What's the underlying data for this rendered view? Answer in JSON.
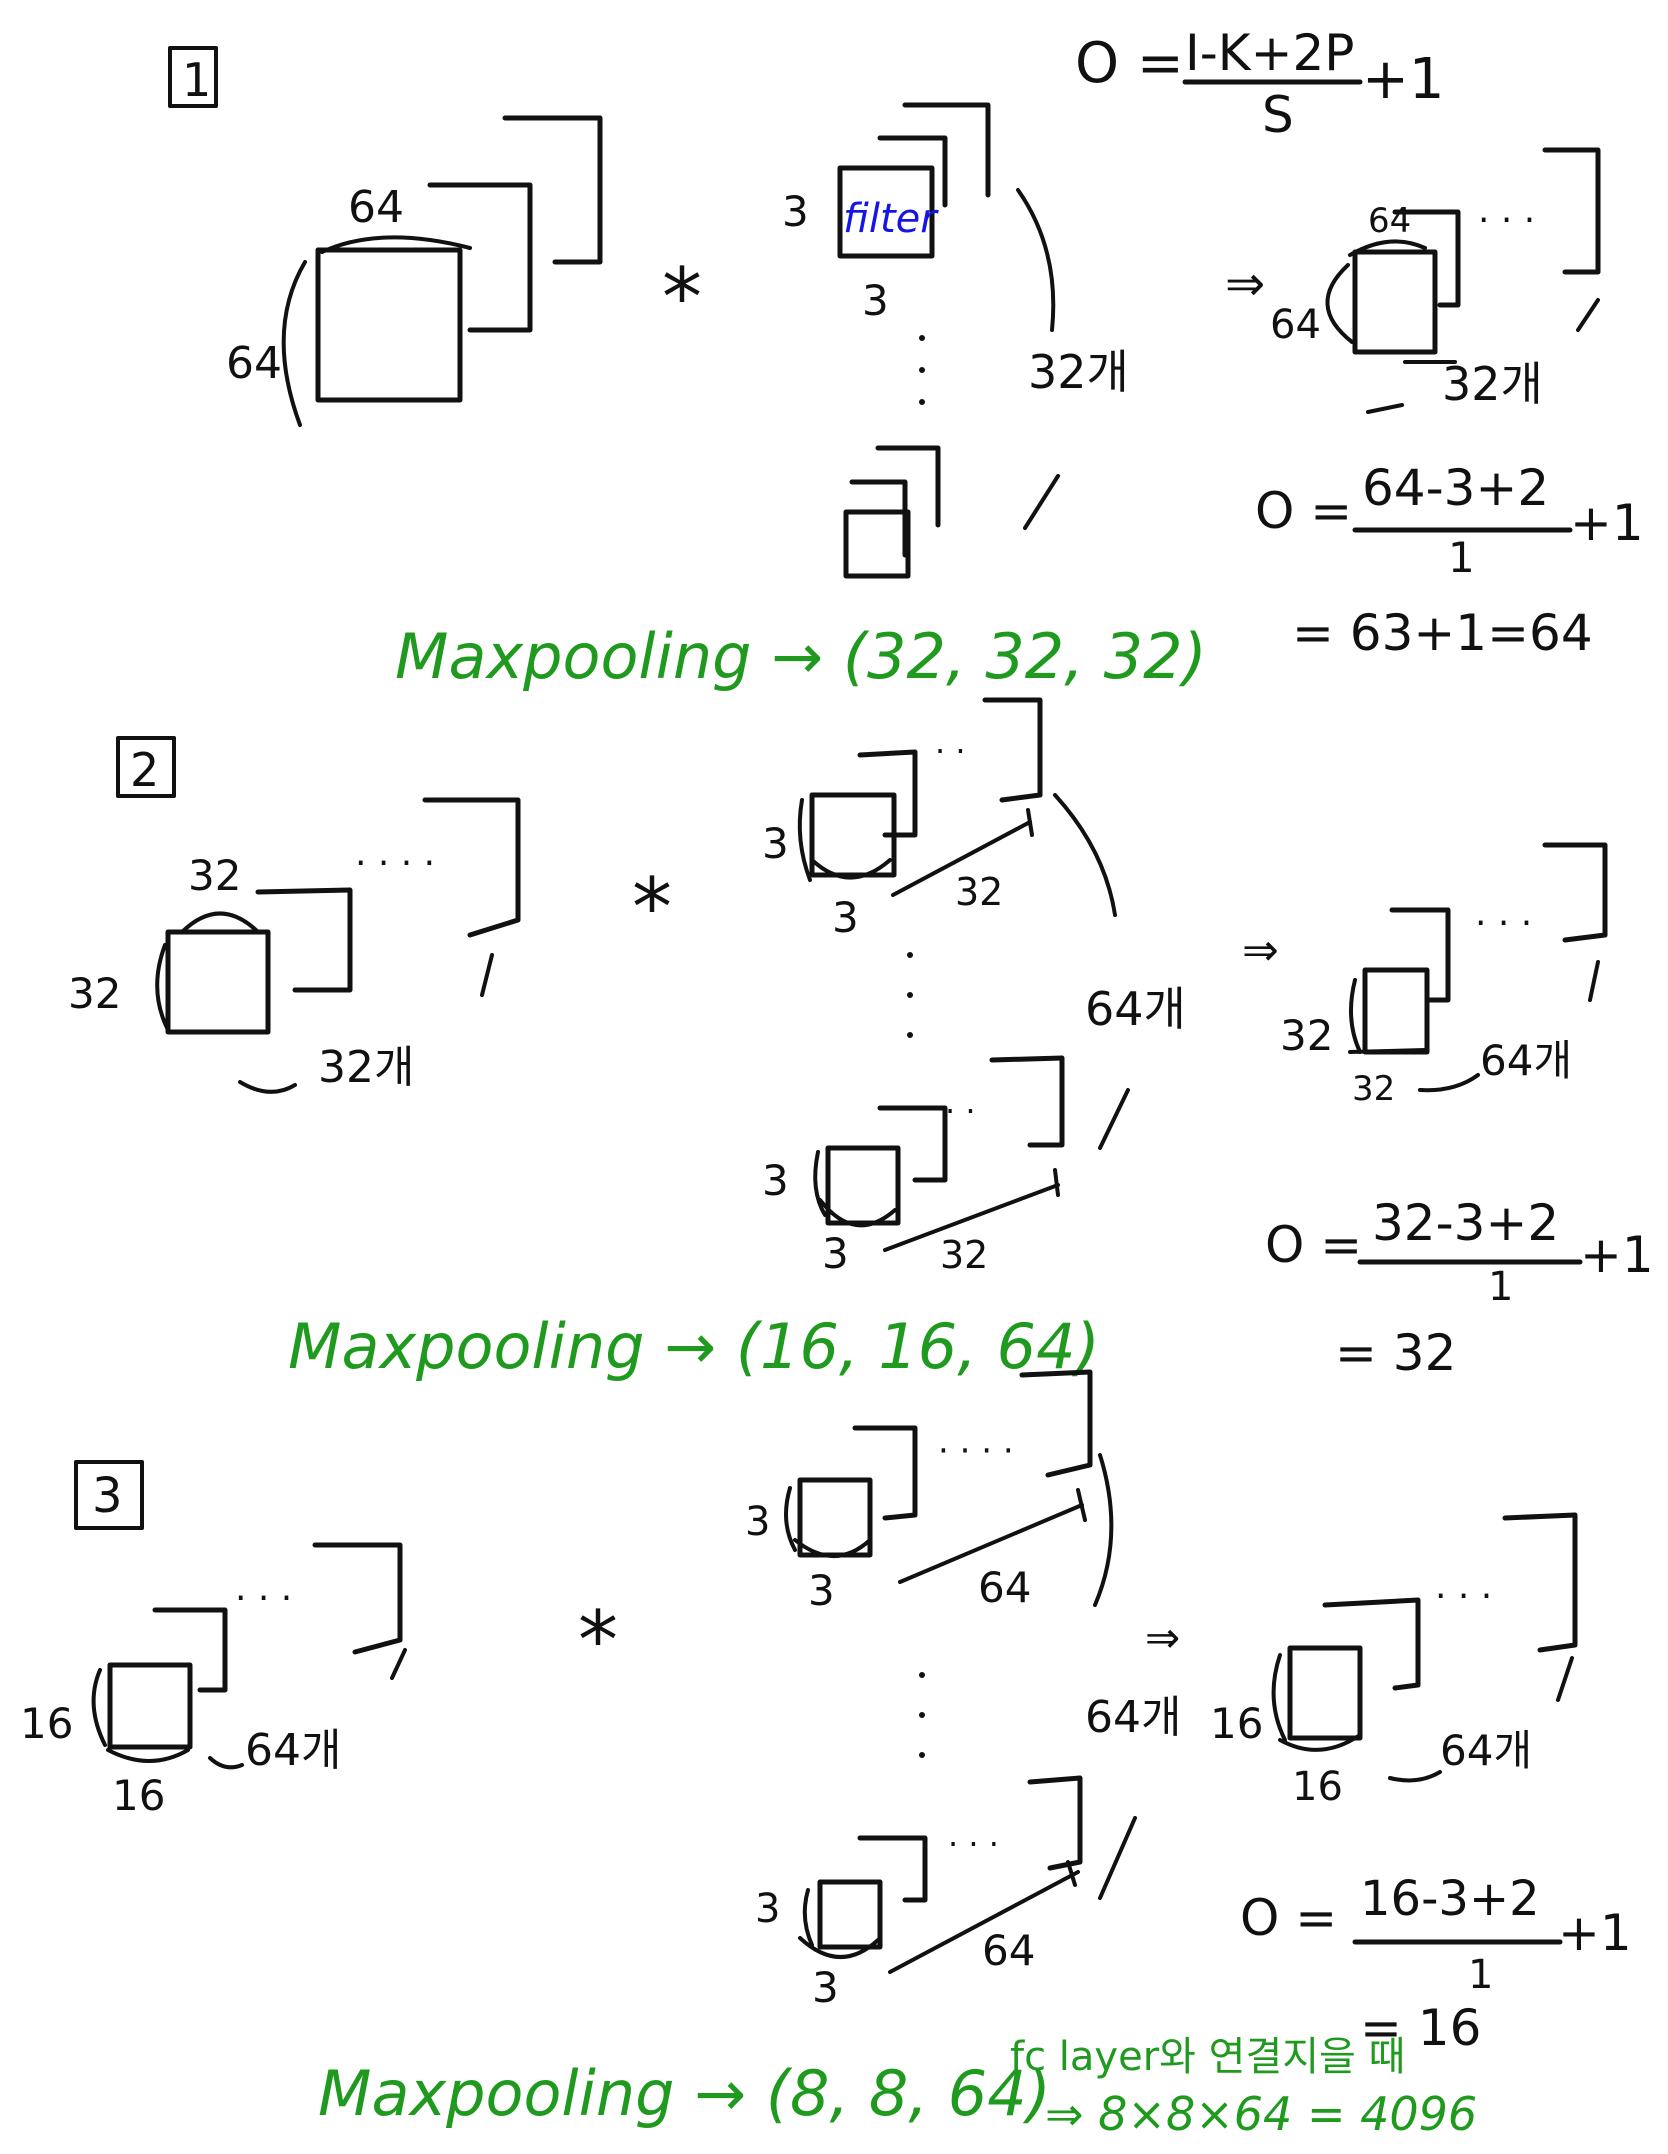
{
  "section_labels": [
    "1",
    "2",
    "3"
  ],
  "operators": {
    "conv": "*",
    "arrow": "⇒"
  },
  "formula_general": {
    "lhs": "O =",
    "numerator": "I-K+2P",
    "denominator": "S",
    "tail": "+1"
  },
  "section1": {
    "input": {
      "width": "64",
      "height": "64"
    },
    "filter": {
      "size_h": "3",
      "size_w": "3",
      "label": "filter",
      "count": "32개"
    },
    "output": {
      "width": "64",
      "height": "64",
      "count": "32개"
    },
    "calc": {
      "lhs": "O =",
      "numerator": "64-3+2",
      "denominator": "1",
      "tail": "+1",
      "result": "= 63+1=64"
    },
    "maxpool": "Maxpooling → (32, 32, 32)"
  },
  "section2": {
    "input": {
      "width": "32",
      "height": "32",
      "count": "32개"
    },
    "filter": {
      "size_h": "3",
      "size_w": "3",
      "depth": "32",
      "count": "64개"
    },
    "output": {
      "width": "32",
      "height": "32",
      "count": "64개"
    },
    "calc": {
      "lhs": "O =",
      "numerator": "32-3+2",
      "denominator": "1",
      "tail": "+1",
      "result": "= 32"
    },
    "maxpool": "Maxpooling → (16, 16, 64)"
  },
  "section3": {
    "input": {
      "width": "16",
      "height": "16",
      "count": "64개"
    },
    "filter": {
      "size_h": "3",
      "size_w": "3",
      "depth": "64",
      "count": "64개"
    },
    "output": {
      "width": "16",
      "height": "16",
      "count": "64개"
    },
    "calc": {
      "lhs": "O =",
      "numerator": "16-3+2",
      "denominator": "1",
      "tail": "+1",
      "result": "= 16"
    },
    "maxpool": "Maxpooling → (8, 8, 64)"
  },
  "fc_note": {
    "line1": "fc layer와 연결지을 때",
    "line2": "⇒ 8×8×64 = 4096"
  },
  "colors": {
    "ink": "#111111",
    "green": "#1f9a1f",
    "blue": "#1515e6"
  }
}
